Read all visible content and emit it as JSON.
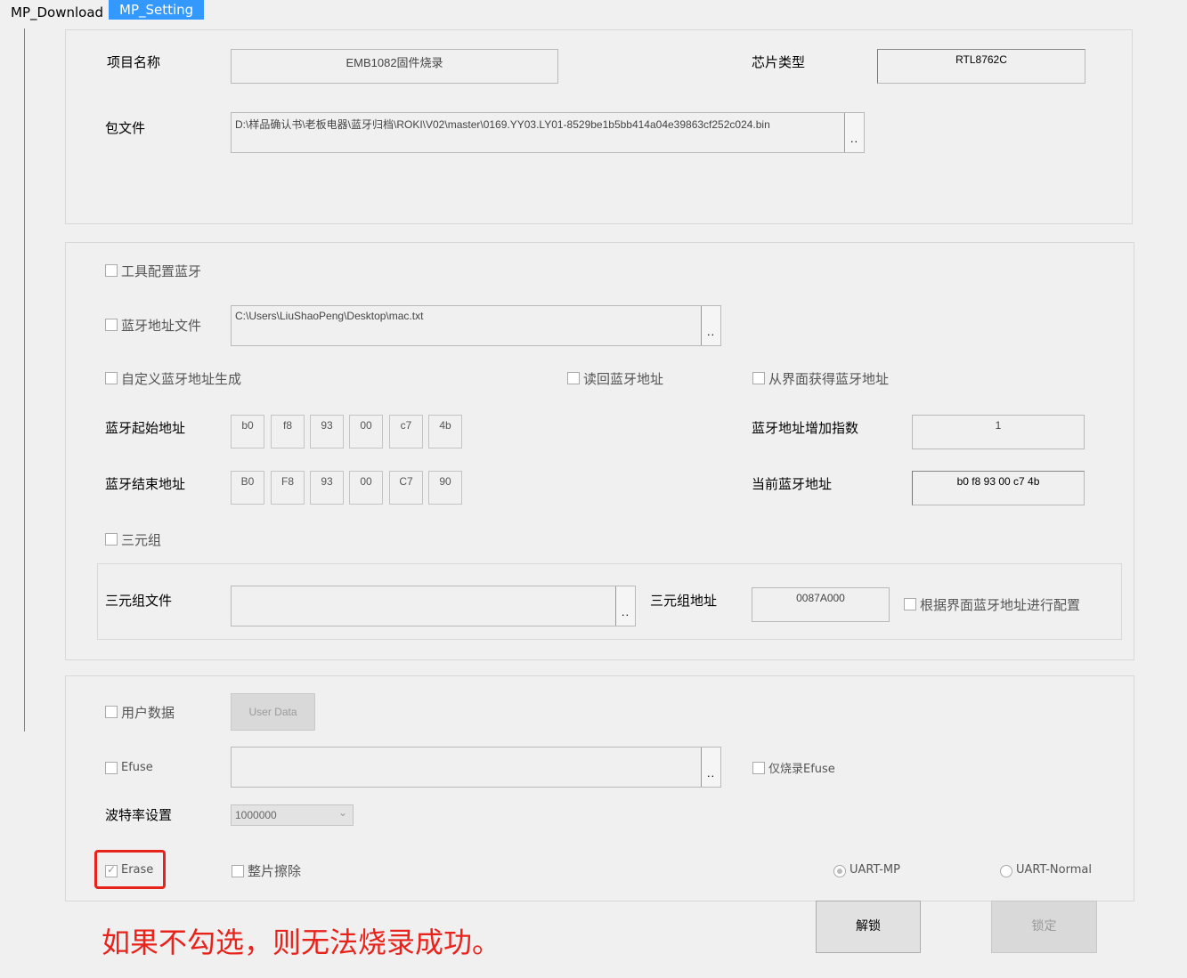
{
  "tabs": [
    {
      "label": "MP_Download"
    },
    {
      "label": "MP_Setting"
    }
  ],
  "project": {
    "name_label": "项目名称",
    "name_value": "EMB1082固件烧录",
    "chip_label": "芯片类型",
    "chip_value": "RTL8762C",
    "package_label": "包文件",
    "package_value": "D:\\样品确认书\\老板电器\\蓝牙归档\\ROKI\\V02\\master\\0169.YY03.LY01-8529be1b5bb414a04e39863cf252c024.bin",
    "browse_label": ".."
  },
  "bt": {
    "tool_config_label": "工具配置蓝牙",
    "addr_file_label": "蓝牙地址文件",
    "addr_file_value": "C:\\Users\\LiuShaoPeng\\Desktop\\mac.txt",
    "custom_gen_label": "自定义蓝牙地址生成",
    "readback_label": "读回蓝牙地址",
    "from_ui_label": "从界面获得蓝牙地址",
    "start_label": "蓝牙起始地址",
    "start_bytes": [
      "b0",
      "f8",
      "93",
      "00",
      "c7",
      "4b"
    ],
    "end_label": "蓝牙结束地址",
    "end_bytes": [
      "B0",
      "F8",
      "93",
      "00",
      "C7",
      "90"
    ],
    "increment_label": "蓝牙地址增加指数",
    "increment_value": "1",
    "current_label": "当前蓝牙地址",
    "current_value": "b0 f8 93 00 c7 4b",
    "triple_label": "三元组",
    "triple_file_label": "三元组文件",
    "triple_file_value": "",
    "triple_addr_label": "三元组地址",
    "triple_addr_value": "0087A000",
    "config_by_ui_label": "根据界面蓝牙地址进行配置"
  },
  "misc": {
    "user_data_label": "用户数据",
    "user_data_button": "User Data",
    "efuse_label": "Efuse",
    "efuse_value": "",
    "efuse_only_label": "仅烧录Efuse",
    "baud_label": "波特率设置",
    "baud_value": "1000000",
    "erase_label": "Erase",
    "full_erase_label": "整片擦除",
    "uart_mp_label": "UART-MP",
    "uart_normal_label": "UART-Normal"
  },
  "buttons": {
    "unlock": "解锁",
    "lock": "锁定"
  },
  "annotation": {
    "note": "如果不勾选，则无法烧录成功。",
    "color": "#e8231c"
  },
  "colors": {
    "tab_active": "#3399ff",
    "background": "#f0f0f0"
  }
}
